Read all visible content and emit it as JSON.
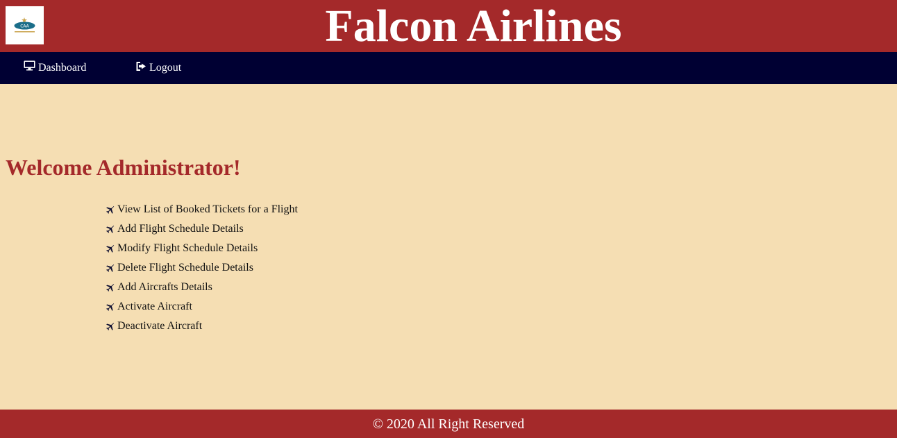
{
  "header": {
    "title": "Falcon Airlines",
    "logo_icon": "caa-logo-icon",
    "logo_text": "CAA"
  },
  "nav": {
    "dashboard_label": "Dashboard",
    "dashboard_icon": "monitor-icon",
    "logout_label": "Logout",
    "logout_icon": "sign-out-icon"
  },
  "main": {
    "welcome": "Welcome Administrator!",
    "menu_icon": "plane-icon",
    "menu": [
      "View List of Booked Tickets for a Flight",
      "Add Flight Schedule Details",
      "Modify Flight Schedule Details",
      "Delete Flight Schedule Details",
      "Add Aircrafts Details",
      "Activate Aircraft",
      "Deactivate Aircraft"
    ]
  },
  "footer": {
    "text": "© 2020 All Right Reserved"
  },
  "colors": {
    "header_bg": "#a4292a",
    "nav_bg": "#000033",
    "page_bg": "#f5deb3",
    "welcome_text": "#a4292a"
  }
}
